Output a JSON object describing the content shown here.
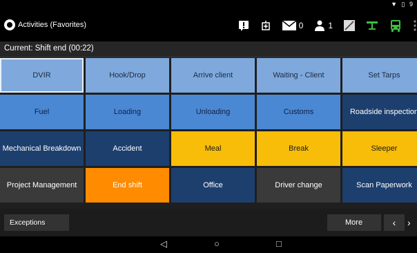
{
  "status_bar": {
    "icons": "▼ ▯ 9"
  },
  "app_bar": {
    "title": "Activities (Favorites)",
    "messages_count": "0",
    "users_count": "1"
  },
  "subheader": {
    "text": "Current:  Shift end (00:22)"
  },
  "tiles": [
    "DVIR",
    "Hook/Drop",
    "Arrive client",
    "Waiting - Client",
    "Set Tarps",
    "Fuel",
    "Loading",
    "Unloading",
    "Customs",
    "Roadside inspection",
    "Mechanical Breakdown",
    "Accident",
    "Meal",
    "Break",
    "Sleeper",
    "Project Management",
    "End shift",
    "Office",
    "Driver change",
    "Scan Paperwork"
  ],
  "bottom": {
    "exceptions": "Exceptions",
    "more": "More",
    "prev": "‹",
    "next": "›"
  },
  "nav": {
    "back": "◁",
    "home": "○",
    "recents": "□"
  },
  "colors": {
    "light_blue": "#7fa9dc",
    "mid_blue": "#4a88d4",
    "dark_blue": "#1d3f6e",
    "yellow": "#f7bd08",
    "orange": "#ff8c00",
    "gray": "#3a3a3a",
    "green": "#3dbf3d"
  }
}
